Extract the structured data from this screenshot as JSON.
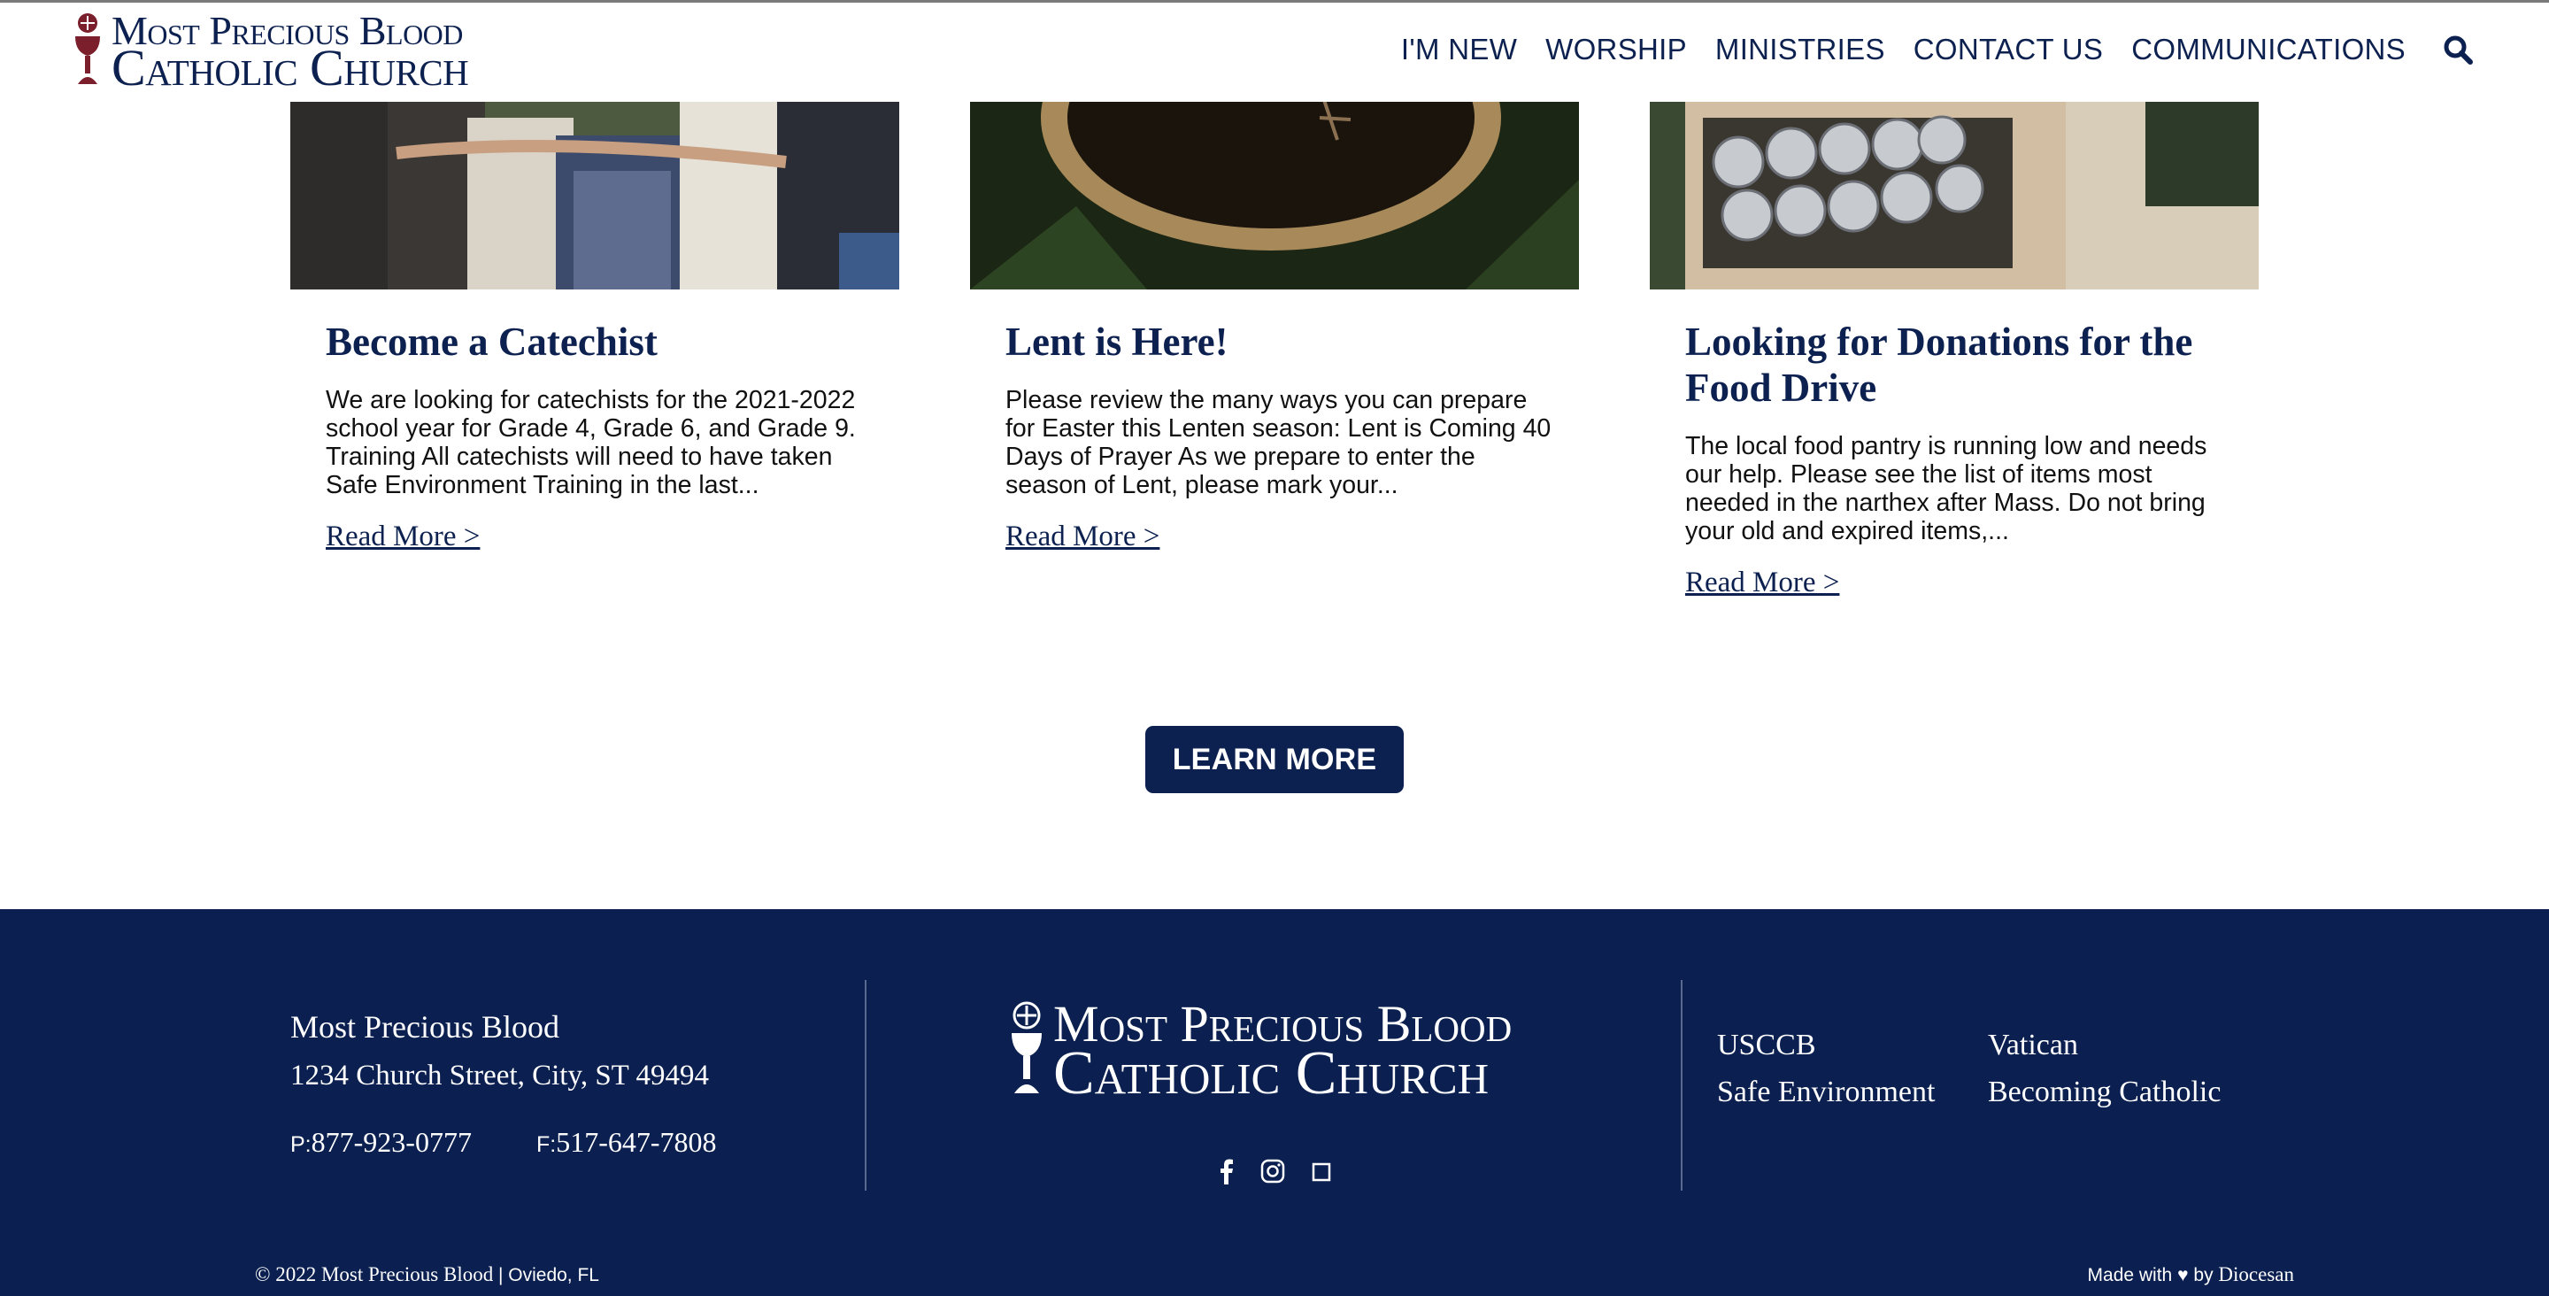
{
  "header": {
    "logo_line1": "Most Precious Blood",
    "logo_line2": "Catholic Church",
    "nav": [
      "I'M NEW",
      "WORSHIP",
      "MINISTRIES",
      "CONTACT US",
      "COMMUNICATIONS"
    ],
    "search_icon": "search-icon"
  },
  "cards": [
    {
      "title": "Become a Catechist",
      "text": "We are looking for catechists for the 2021-2022 school year for Grade 4, Grade 6, and Grade 9. Training All catechists will need to have taken Safe Environment Training in the last...",
      "read_more": "Read More >"
    },
    {
      "title": "Lent is Here!",
      "text": "Please review the many ways you can prepare for Easter this Lenten season: Lent is Coming 40 Days of Prayer As we prepare to enter the season of Lent, please mark your...",
      "read_more": "Read More >"
    },
    {
      "title": "Looking for Donations for the Food Drive",
      "text": "The local food pantry is running low and needs our help. Please see the list of items most needed in the narthex after Mass. Do not bring your old and expired items,...",
      "read_more": "Read More >"
    }
  ],
  "learn_more": "LEARN MORE",
  "footer": {
    "name": "Most Precious Blood",
    "street": "1234 Church Street, City, ST 49494",
    "phone_prefix": "P:",
    "phone": "877-923-0777",
    "fax_prefix": "F:",
    "fax": "517-647-7808",
    "logo_line1": "Most Precious Blood",
    "logo_line2": "Catholic Church",
    "social_icons": [
      "facebook-icon",
      "instagram-icon",
      "square-icon"
    ],
    "links": [
      "USCCB",
      "Vatican",
      "Safe Environment",
      "Becoming Catholic"
    ],
    "copyright": "© 2022 Most Precious Blood",
    "copyright_location": "| Oviedo, FL",
    "made_with": "Made with",
    "made_by": "by",
    "made_brand": "Diocesan"
  },
  "colors": {
    "navy": "#0d2150",
    "footer_bg": "#0b2050",
    "chalice_red": "#7a1f2b"
  }
}
